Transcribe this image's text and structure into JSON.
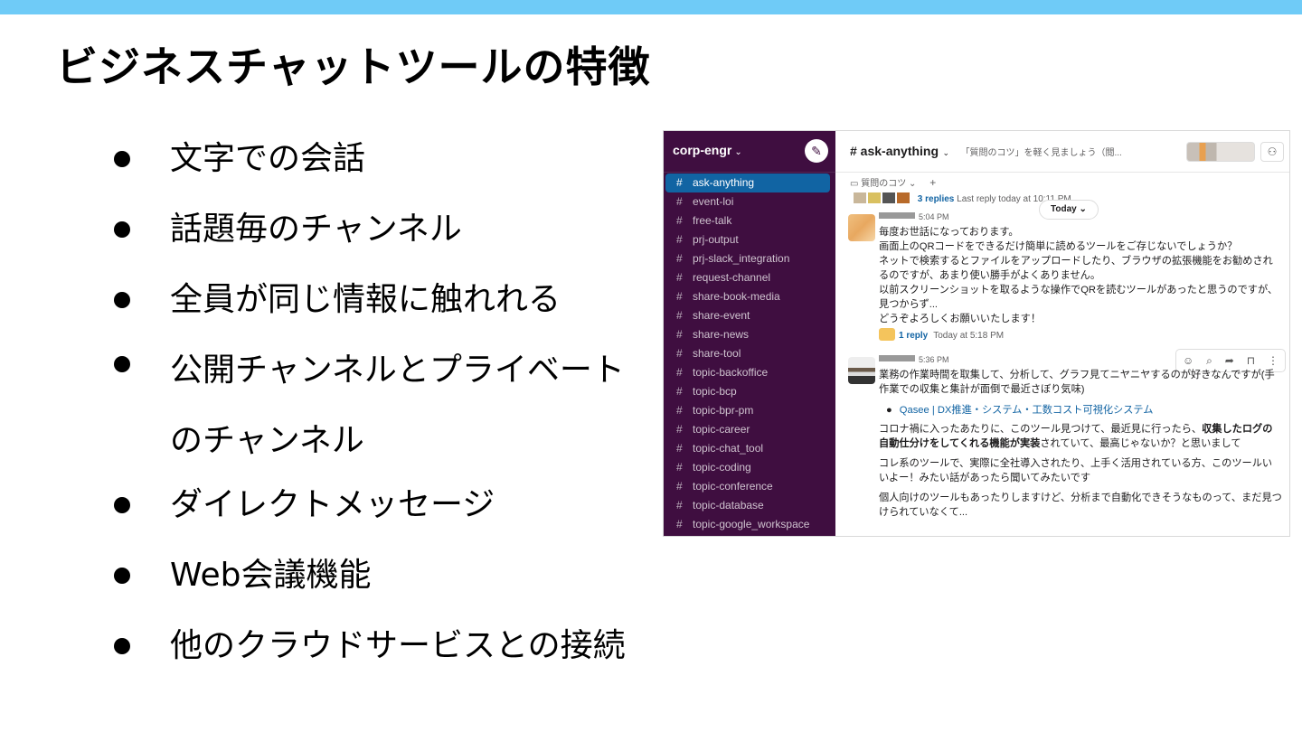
{
  "slide": {
    "title": "ビジネスチャットツールの特徴",
    "bullets": [
      "文字での会話",
      "話題毎のチャンネル",
      "全員が同じ情報に触れれる",
      "公開チャンネルとプライベートのチャンネル",
      "ダイレクトメッセージ",
      "Web会議機能",
      "他のクラウドサービスとの接続"
    ],
    "accent_color": "#6fcbf7"
  },
  "slack": {
    "workspace": {
      "name": "corp-engr",
      "chevron_icon": "chevron-down-icon",
      "compose_icon": "compose-icon"
    },
    "channels": [
      "ask-anything",
      "event-loi",
      "free-talk",
      "prj-output",
      "prj-slack_integration",
      "request-channel",
      "share-book-media",
      "share-event",
      "share-news",
      "share-tool",
      "topic-backoffice",
      "topic-bcp",
      "topic-bpr-pm",
      "topic-career",
      "topic-chat_tool",
      "topic-coding",
      "topic-conference",
      "topic-database",
      "topic-google_workspace"
    ],
    "active_channel": "ask-anything",
    "header": {
      "channel": "# ask-anything",
      "topic": "「質問のコツ」を軽く見ましょう（閲...",
      "add_user_icon": "add-user-icon"
    },
    "bookmark": {
      "label": "質問のコツ ⌄",
      "plus": "+"
    },
    "thread_summary": {
      "replies": "3 replies",
      "last": "Last reply today at 10:11 PM"
    },
    "date_divider": "Today ⌄",
    "message1": {
      "time": "5:04 PM",
      "lines": [
        "毎度お世話になっております。",
        "画面上のQRコードをできるだけ簡単に読めるツールをご存じないでしょうか？",
        "ネットで検索するとファイルをアップロードしたり、ブラウザの拡張機能をお勧めされるのですが、あまり使い勝手がよくありません。",
        "以前スクリーンショットを取るような操作でQRを読むツールがあったと思うのですが、見つからず...",
        "どうぞよろしくお願いいたします！"
      ],
      "reply_count": "1 reply",
      "reply_time": "Today at 5:18 PM"
    },
    "message2": {
      "time": "5:36 PM",
      "intro": "業務の作業時間を取集して、分析して、グラフ見てニヤニヤするのが好きなんですが(手作業での収集と集計が面倒で最近さぼり気味)",
      "link": "Qasee | DX推進・システム・工数コスト可視化システム",
      "p2_start": "コロナ禍に入ったあたりに、このツール見つけて、最近見に行ったら、",
      "p2_bold": "収集したログの自動仕分けをしてくれる機能が実装",
      "p2_end": "されていて、最高じゃないか？と思いまして",
      "p3": "コレ系のツールで、実際に全社導入されたり、上手く活用されている方、このツールいいよー！みたい話があったら聞いてみたいです",
      "p4": "個人向けのツールもあったりしますけど、分析まで自動化できそうなものって、まだ見つけられていなくて..."
    },
    "toolbar_icons": [
      "emoji-icon",
      "thread-icon",
      "share-icon",
      "bookmark-icon",
      "more-icon"
    ],
    "colors": {
      "sidebar": "#3f0e40",
      "active": "#1164a3",
      "link": "#1264a3"
    }
  }
}
